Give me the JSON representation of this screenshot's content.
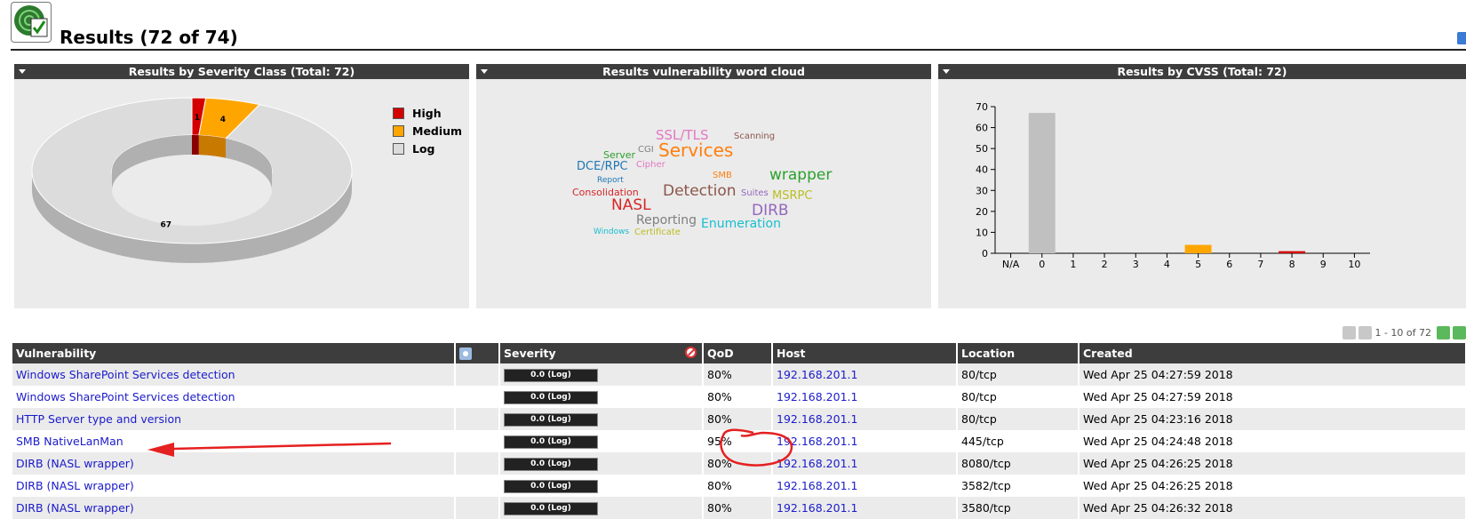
{
  "page": {
    "title": "Results (72 of 74)"
  },
  "panels": {
    "severity": {
      "title": "Results by Severity Class (Total: 72)",
      "legend": [
        {
          "label": "High",
          "color": "#d40000"
        },
        {
          "label": "Medium",
          "color": "#ffa500"
        },
        {
          "label": "Log",
          "color": "#dcdcdc"
        }
      ]
    },
    "wordcloud": {
      "title": "Results vulnerability word cloud",
      "words": [
        {
          "text": "SSL/TLS",
          "color": "#e377c2",
          "size": 15
        },
        {
          "text": "Scanning",
          "color": "#8c564b",
          "size": 10
        },
        {
          "text": "Server",
          "color": "#2ca02c",
          "size": 11
        },
        {
          "text": "CGI",
          "color": "#7f7f7f",
          "size": 10
        },
        {
          "text": "Services",
          "color": "#ff7f0e",
          "size": 20
        },
        {
          "text": "DCE/RPC",
          "color": "#1f77b4",
          "size": 13
        },
        {
          "text": "Cipher",
          "color": "#e377c2",
          "size": 10
        },
        {
          "text": "SMB",
          "color": "#ff7f0e",
          "size": 10
        },
        {
          "text": "wrapper",
          "color": "#2ca02c",
          "size": 17
        },
        {
          "text": "Report",
          "color": "#1f77b4",
          "size": 9
        },
        {
          "text": "Detection",
          "color": "#8c564b",
          "size": 17
        },
        {
          "text": "Consolidation",
          "color": "#d62728",
          "size": 11
        },
        {
          "text": "Suites",
          "color": "#9467bd",
          "size": 10
        },
        {
          "text": "MSRPC",
          "color": "#bcbd22",
          "size": 13
        },
        {
          "text": "NASL",
          "color": "#d62728",
          "size": 17
        },
        {
          "text": "DIRB",
          "color": "#9467bd",
          "size": 17
        },
        {
          "text": "Reporting",
          "color": "#7f7f7f",
          "size": 14
        },
        {
          "text": "Enumeration",
          "color": "#17becf",
          "size": 14
        },
        {
          "text": "Windows",
          "color": "#17becf",
          "size": 9
        },
        {
          "text": "Certificate",
          "color": "#bcbd22",
          "size": 10
        }
      ]
    },
    "cvss": {
      "title": "Results by CVSS (Total: 72)"
    }
  },
  "chart_data": [
    {
      "type": "pie",
      "title": "Results by Severity Class (Total: 72)",
      "categories": [
        "High",
        "Medium",
        "Log"
      ],
      "values": [
        1,
        4,
        67
      ],
      "colors": [
        "#d40000",
        "#ffa500",
        "#dcdcdc"
      ],
      "legend": "right"
    },
    {
      "type": "bar",
      "title": "Results by CVSS (Total: 72)",
      "categories": [
        "N/A",
        "0",
        "1",
        "2",
        "3",
        "4",
        "5",
        "6",
        "7",
        "8",
        "9",
        "10"
      ],
      "values": [
        0,
        67,
        0,
        0,
        0,
        0,
        4,
        0,
        0,
        1,
        0,
        0
      ],
      "colors": [
        "#c0c0c0",
        "#c0c0c0",
        "#c0c0c0",
        "#c0c0c0",
        "#c0c0c0",
        "#ffa500",
        "#ffa500",
        "#ffa500",
        "#d40000",
        "#d40000",
        "#d40000",
        "#d40000"
      ],
      "ylim": [
        0,
        70
      ],
      "yticks": [
        "0",
        "10",
        "20",
        "30",
        "40",
        "50",
        "60",
        "70"
      ]
    }
  ],
  "pager": {
    "text": "1 - 10 of 72"
  },
  "table": {
    "headers": {
      "vulnerability": "Vulnerability",
      "severity": "Severity",
      "qod": "QoD",
      "host": "Host",
      "location": "Location",
      "created": "Created"
    },
    "rows": [
      {
        "vulnerability": "Windows SharePoint Services detection",
        "severity": "0.0 (Log)",
        "qod": "80%",
        "host": "192.168.201.1",
        "location": "80/tcp",
        "created": "Wed Apr 25 04:27:59 2018"
      },
      {
        "vulnerability": "Windows SharePoint Services detection",
        "severity": "0.0 (Log)",
        "qod": "80%",
        "host": "192.168.201.1",
        "location": "80/tcp",
        "created": "Wed Apr 25 04:27:59 2018"
      },
      {
        "vulnerability": "HTTP Server type and version",
        "severity": "0.0 (Log)",
        "qod": "80%",
        "host": "192.168.201.1",
        "location": "80/tcp",
        "created": "Wed Apr 25 04:23:16 2018"
      },
      {
        "vulnerability": "SMB NativeLanMan",
        "severity": "0.0 (Log)",
        "qod": "95%",
        "host": "192.168.201.1",
        "location": "445/tcp",
        "created": "Wed Apr 25 04:24:48 2018"
      },
      {
        "vulnerability": "DIRB (NASL wrapper)",
        "severity": "0.0 (Log)",
        "qod": "80%",
        "host": "192.168.201.1",
        "location": "8080/tcp",
        "created": "Wed Apr 25 04:26:25 2018"
      },
      {
        "vulnerability": "DIRB (NASL wrapper)",
        "severity": "0.0 (Log)",
        "qod": "80%",
        "host": "192.168.201.1",
        "location": "3582/tcp",
        "created": "Wed Apr 25 04:26:25 2018"
      },
      {
        "vulnerability": "DIRB (NASL wrapper)",
        "severity": "0.0 (Log)",
        "qod": "80%",
        "host": "192.168.201.1",
        "location": "3580/tcp",
        "created": "Wed Apr 25 04:26:32 2018"
      }
    ]
  }
}
